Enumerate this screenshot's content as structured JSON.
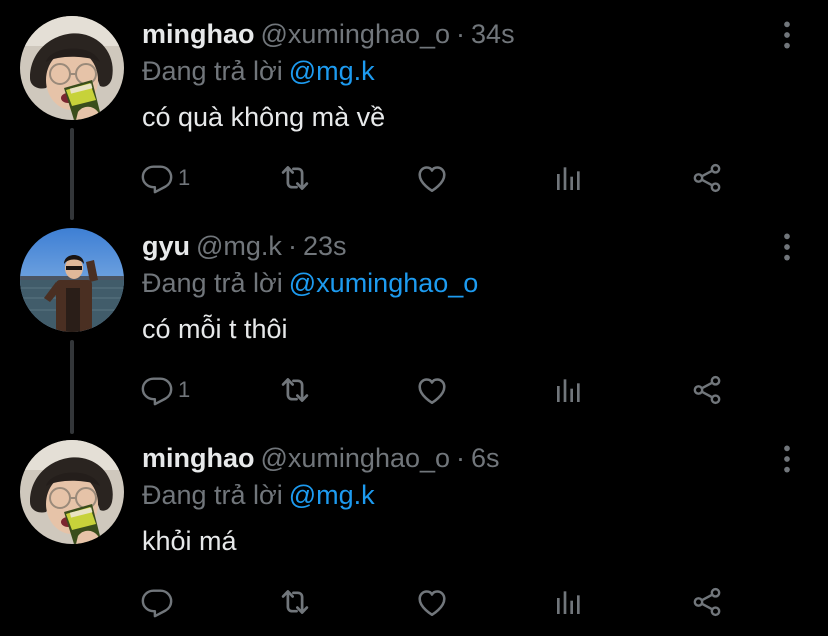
{
  "colors": {
    "background": "#000000",
    "text_primary": "#e7e9ea",
    "text_secondary": "#71767b",
    "link": "#1d9bf0",
    "thread_line": "#333639"
  },
  "tweets": [
    {
      "display_name": "minghao",
      "handle": "@xuminghao_o",
      "separator": "·",
      "time": "34s",
      "replying_label": "Đang trả lời",
      "replying_to": "@mg.k",
      "text": "có quà không mà về",
      "reply_count": "1",
      "avatar": "minghao-avatar",
      "icons": [
        "reply-icon",
        "retweet-icon",
        "like-icon",
        "views-icon",
        "share-icon",
        "more-icon"
      ]
    },
    {
      "display_name": "gyu",
      "handle": "@mg.k",
      "separator": "·",
      "time": "23s",
      "replying_label": "Đang trả lời",
      "replying_to": "@xuminghao_o",
      "text": "có mỗi t thôi",
      "reply_count": "1",
      "avatar": "gyu-avatar",
      "icons": [
        "reply-icon",
        "retweet-icon",
        "like-icon",
        "views-icon",
        "share-icon",
        "more-icon"
      ]
    },
    {
      "display_name": "minghao",
      "handle": "@xuminghao_o",
      "separator": "·",
      "time": "6s",
      "replying_label": "Đang trả lời",
      "replying_to": "@mg.k",
      "text": "khỏi má",
      "reply_count": "",
      "avatar": "minghao-avatar",
      "icons": [
        "reply-icon",
        "retweet-icon",
        "like-icon",
        "views-icon",
        "share-icon",
        "more-icon"
      ]
    }
  ]
}
